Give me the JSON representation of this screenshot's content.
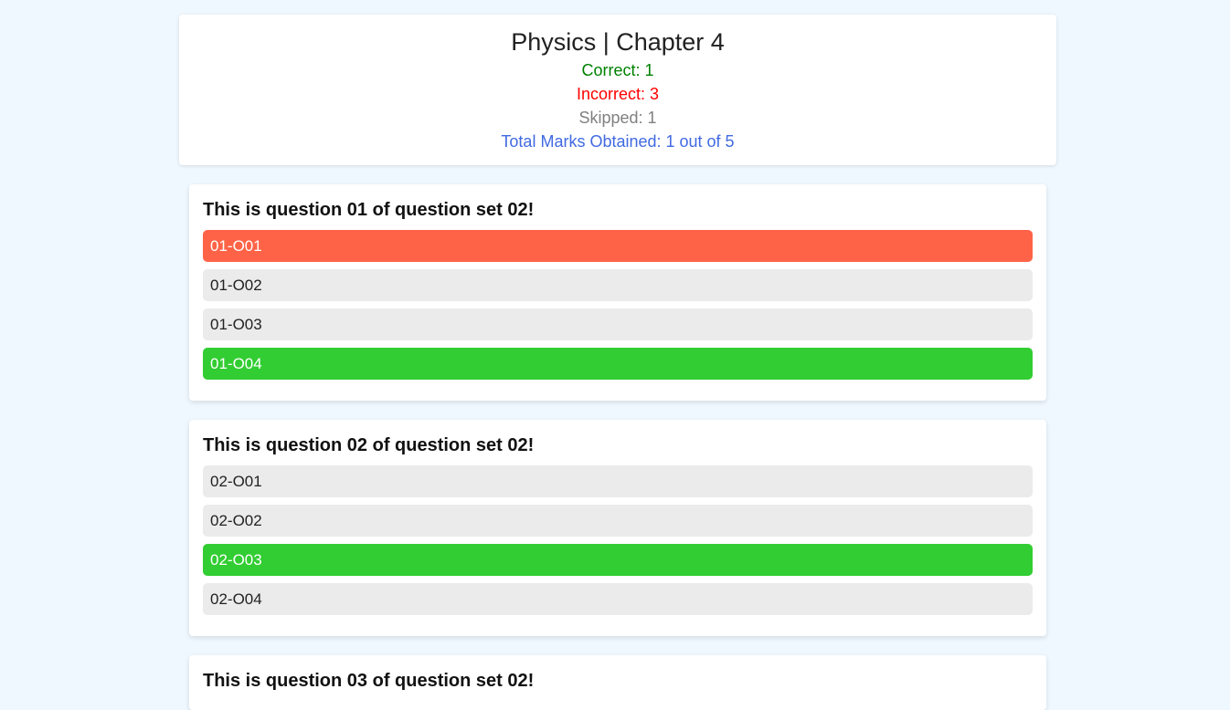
{
  "summary": {
    "title": "Physics | Chapter 4",
    "correct": "Correct: 1",
    "incorrect": "Incorrect: 3",
    "skipped": "Skipped: 1",
    "total": "Total Marks Obtained: 1 out of 5"
  },
  "colors": {
    "correct": "#32cd32",
    "wrong": "#ff6347",
    "neutral": "#ebebeb",
    "correct_text": "#008000",
    "incorrect_text": "#ff0000",
    "skipped_text": "#808080",
    "total_text": "#4169e1"
  },
  "questions": [
    {
      "text": "This is question 01 of question set 02!",
      "options": [
        {
          "label": "01-O01",
          "state": "wrong"
        },
        {
          "label": "01-O02",
          "state": "neutral"
        },
        {
          "label": "01-O03",
          "state": "neutral"
        },
        {
          "label": "01-O04",
          "state": "correct"
        }
      ]
    },
    {
      "text": "This is question 02 of question set 02!",
      "options": [
        {
          "label": "02-O01",
          "state": "neutral"
        },
        {
          "label": "02-O02",
          "state": "neutral"
        },
        {
          "label": "02-O03",
          "state": "correct"
        },
        {
          "label": "02-O04",
          "state": "neutral"
        }
      ]
    },
    {
      "text": "This is question 03 of question set 02!",
      "options": []
    }
  ]
}
